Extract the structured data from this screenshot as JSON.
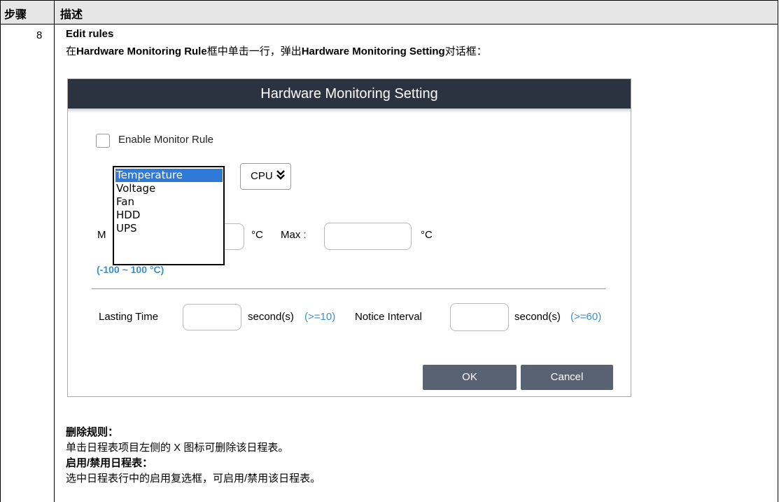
{
  "table": {
    "header": {
      "col1": "步骤",
      "col2": "描述"
    },
    "step": "8",
    "title": "Edit rules",
    "intro": {
      "p1": "在",
      "b1": "Hardware Monitoring Rule",
      "p2": "框中单击一行，弹出",
      "b2": "Hardware Monitoring Setting",
      "p3": "对话框："
    }
  },
  "dialog": {
    "title": "Hardware Monitoring Setting",
    "enable_label": "Enable Monitor Rule",
    "enable_checked": false,
    "type_options": [
      "Temperature",
      "Voltage",
      "Fan",
      "HDD",
      "UPS"
    ],
    "type_selected": "Temperature",
    "device_value": "CPU",
    "device_chevron": "❯❯",
    "min_label_partial": "M",
    "min_value": "",
    "unit": "°C",
    "max_label": "Max :",
    "max_value": "",
    "range_hint": "(-100 ~ 100 °C)",
    "lasting_label": "Lasting Time",
    "lasting_value": "",
    "lasting_unit": "second(s)",
    "lasting_hint": "(>=10)",
    "notice_label": "Notice Interval",
    "notice_value": "",
    "notice_unit": "second(s)",
    "notice_hint": "(>=60)",
    "ok_label": "OK",
    "cancel_label": "Cancel"
  },
  "notes": {
    "delete_heading": "删除规则：",
    "delete_text": "单击日程表项目左侧的 X 图标可删除该日程表。",
    "enable_heading": "启用/禁用日程表：",
    "enable_text": "选中日程表行中的启用复选框，可启用/禁用该日程表。"
  },
  "colors": {
    "dialog_title_bg": "#2b3340",
    "button_bg": "#586272",
    "hint_blue": "#3a8fd1",
    "selected_option": "#2f7ad9"
  }
}
